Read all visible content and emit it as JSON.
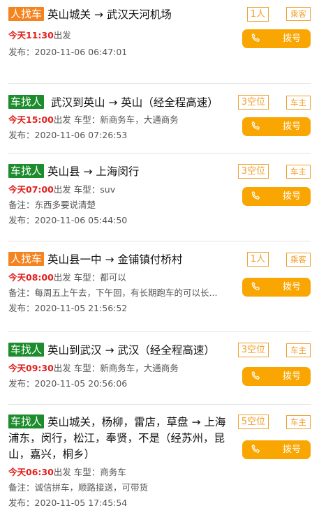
{
  "listings": [
    {
      "tag": "人找车",
      "tag_color": "orange",
      "route": "英山城关 → 武汉天河机场",
      "capacity": "1人",
      "role": "乘客",
      "time": "今天11:30",
      "depart_suffix": "出发",
      "car_type": "",
      "note": "",
      "published": "发布：2020-11-06 06:47:01"
    },
    {
      "tag": "车找人",
      "tag_color": "green",
      "route": " 武汉到英山 → 英山（经全程高速）",
      "capacity": "3空位",
      "role": "车主",
      "time": "今天15:00",
      "depart_suffix": "出发",
      "car_type": "车型：新商务车，大通商务",
      "note": "",
      "published": "发布：2020-11-06 07:26:53"
    },
    {
      "tag": "车找人",
      "tag_color": "green",
      "route": "英山县 → 上海闵行",
      "capacity": "3空位",
      "role": "车主",
      "time": "今天07:00",
      "depart_suffix": "出发",
      "car_type": "车型：suv",
      "note": "备注：东西多要说清楚",
      "published": "发布：2020-11-06 05:44:50"
    },
    {
      "tag": "人找车",
      "tag_color": "orange",
      "route": "英山县一中 → 金铺镇付桥村",
      "capacity": "1人",
      "role": "乘客",
      "time": "今天08:00",
      "depart_suffix": "出发",
      "car_type": "车型：都可以",
      "note": "备注：每周五上午去，下午回，有长期跑车的可以长...",
      "published": "发布：2020-11-05 21:56:52"
    },
    {
      "tag": "车找人",
      "tag_color": "green",
      "route": "英山到武汉 → 武汉（经全程高速）",
      "capacity": "3空位",
      "role": "车主",
      "time": "今天09:30",
      "depart_suffix": "出发",
      "car_type": "车型：新商务车，大通商务",
      "note": "",
      "published": "发布：2020-11-05 20:56:06"
    },
    {
      "tag": "车找人",
      "tag_color": "green",
      "route": "英山城关，杨柳，雷店，草盘 → 上海浦东，闵行，松江，奉贤，不是（经苏州，昆山，嘉兴，桐乡）",
      "capacity": "5空位",
      "role": "车主",
      "time": "今天06:30",
      "depart_suffix": "出发",
      "car_type": "车型：商务车",
      "note": "备注：诚信拼车，顺路接送，可带货",
      "published": "发布：2020-11-05 17:45:54"
    }
  ],
  "dial_label": "拨号",
  "colors": {
    "orange_tag": "#f5841f",
    "green_tag": "#1d8c2d",
    "accent": "#f9a602",
    "time": "#e0201b"
  }
}
